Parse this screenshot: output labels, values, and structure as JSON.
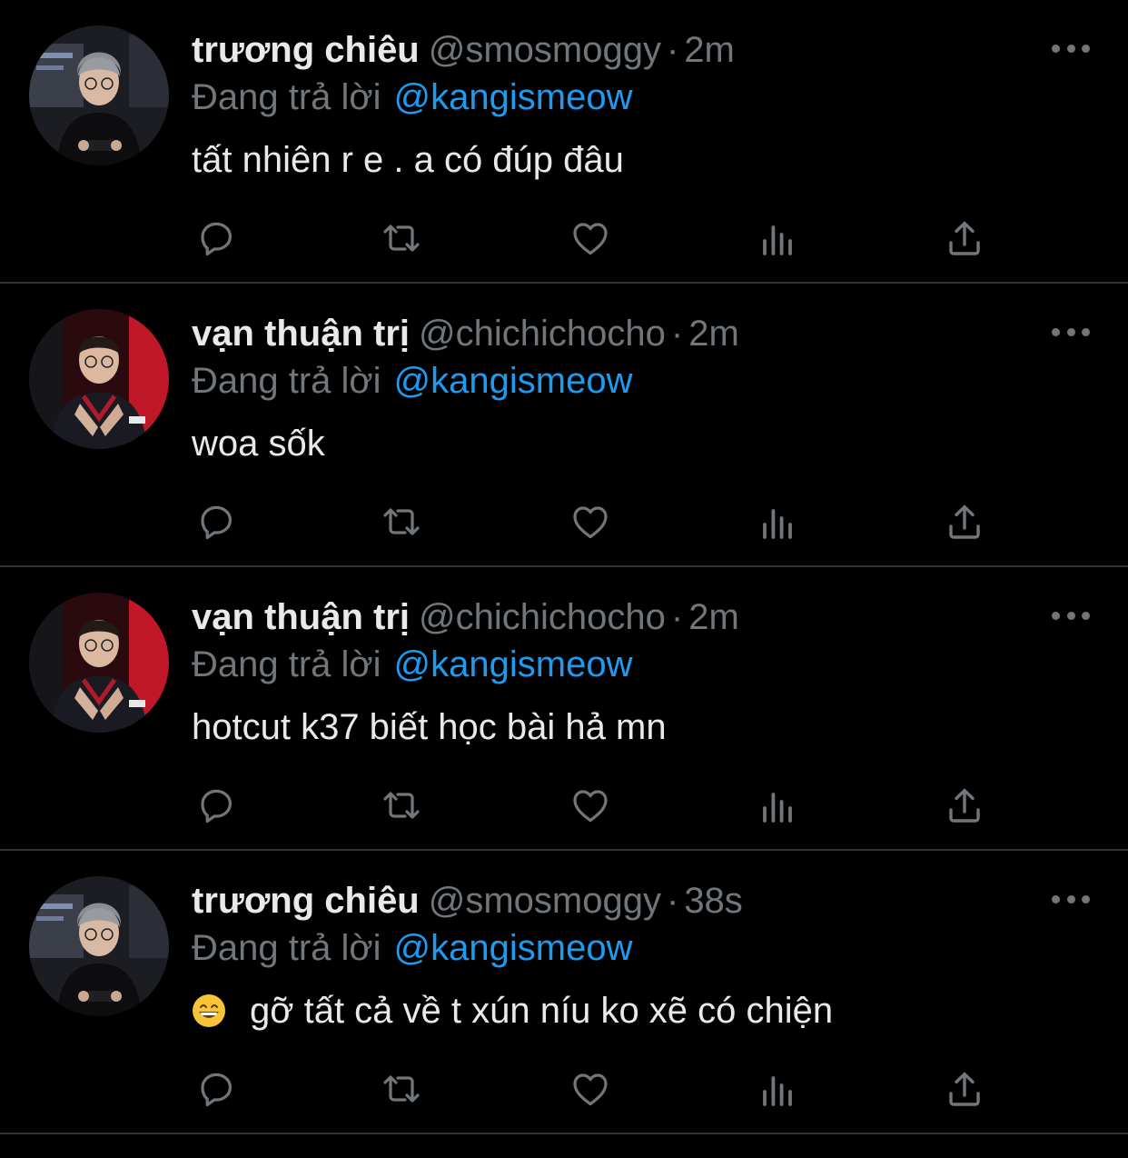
{
  "colors": {
    "background": "#000000",
    "divider": "#2f3336",
    "text": "#e7e9ea",
    "secondary": "#71767b",
    "link": "#1d9bf0"
  },
  "tweets": [
    {
      "name": "trương chiêu",
      "handle": "@smosmoggy",
      "separator": "·",
      "time": "2m",
      "reply_label": "Đang trả lời",
      "reply_to": "@kangismeow",
      "text": "tất nhiên r e . a có đúp đâu",
      "avatar_icon": "avatar-grey-beanie",
      "has_emoji": false
    },
    {
      "name": "vạn thuận trị",
      "handle": "@chichichocho",
      "separator": "·",
      "time": "2m",
      "reply_label": "Đang trả lời",
      "reply_to": "@kangismeow",
      "text": "woa sốk",
      "avatar_icon": "avatar-red-jersey",
      "has_emoji": false
    },
    {
      "name": "vạn thuận trị",
      "handle": "@chichichocho",
      "separator": "·",
      "time": "2m",
      "reply_label": "Đang trả lời",
      "reply_to": "@kangismeow",
      "text": "hotcut k37 biết học bài hả mn",
      "avatar_icon": "avatar-red-jersey",
      "has_emoji": false
    },
    {
      "name": "trương chiêu",
      "handle": "@smosmoggy",
      "separator": "·",
      "time": "38s",
      "reply_label": "Đang trả lời",
      "reply_to": "@kangismeow",
      "text": "gỡ tất cả về t xún níu ko xẽ có chiện",
      "avatar_icon": "avatar-grey-beanie",
      "has_emoji": true,
      "emoji_icon": "grinning-face-emoji"
    }
  ],
  "action_icons": [
    "reply-icon",
    "retweet-icon",
    "like-icon",
    "views-icon",
    "share-icon"
  ]
}
